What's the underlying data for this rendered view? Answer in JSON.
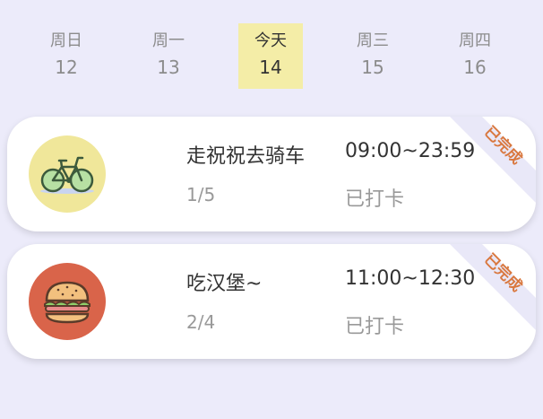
{
  "week": [
    {
      "name": "周日",
      "num": "12"
    },
    {
      "name": "周一",
      "num": "13"
    },
    {
      "name": "今天",
      "num": "14"
    },
    {
      "name": "周三",
      "num": "15"
    },
    {
      "name": "周四",
      "num": "16"
    }
  ],
  "tasks": [
    {
      "title": "走祝祝去骑车",
      "time": "09:00~23:59",
      "count": "1/5",
      "status": "已打卡",
      "badge": "已完成",
      "icon": "bicycle-icon",
      "icon_bg": "#f0e79a"
    },
    {
      "title": "吃汉堡~",
      "time": "11:00~12:30",
      "count": "2/4",
      "status": "已打卡",
      "badge": "已完成",
      "icon": "burger-icon",
      "icon_bg": "#d9644a"
    }
  ],
  "colors": {
    "background": "#ecebfa",
    "today_highlight": "#f4eda7",
    "badge_text": "#d9783f",
    "badge_ribbon": "#e9e8f8"
  }
}
